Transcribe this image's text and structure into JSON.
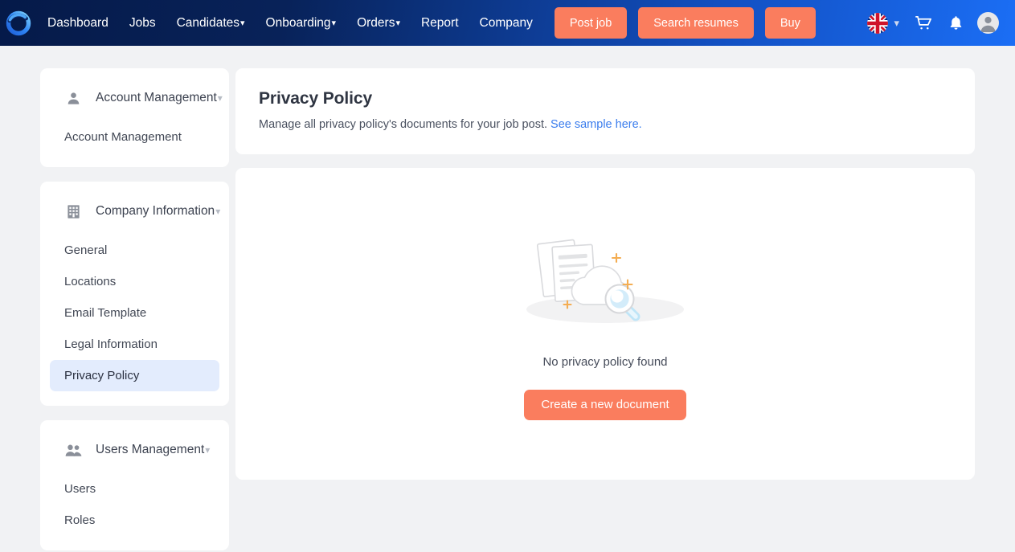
{
  "navbar": {
    "logo_icon": "brand-ring-logo",
    "links": [
      {
        "label": "Dashboard",
        "has_caret": false
      },
      {
        "label": "Jobs",
        "has_caret": false
      },
      {
        "label": "Candidates",
        "has_caret": true
      },
      {
        "label": "Onboarding",
        "has_caret": true
      },
      {
        "label": "Orders",
        "has_caret": true
      },
      {
        "label": "Report",
        "has_caret": false
      },
      {
        "label": "Company",
        "has_caret": false
      }
    ],
    "buttons": [
      {
        "label": "Post job"
      },
      {
        "label": "Search resumes"
      },
      {
        "label": "Buy"
      }
    ],
    "language": {
      "flag": "uk-flag-icon",
      "caret": "⌄"
    },
    "icons": [
      {
        "name": "cart-icon"
      },
      {
        "name": "bell-icon"
      },
      {
        "name": "avatar-icon"
      }
    ],
    "accent_color": "#fa7d5e",
    "gradient_from": "#051a49",
    "gradient_to": "#1b6ef5"
  },
  "sidebar": {
    "sections": [
      {
        "icon": "person-icon",
        "title": "Account Management",
        "caret": "⌄",
        "items": [
          {
            "label": "Account Management",
            "active": false
          }
        ]
      },
      {
        "icon": "building-icon",
        "title": "Company Information",
        "caret": "⌄",
        "items": [
          {
            "label": "General",
            "active": false
          },
          {
            "label": "Locations",
            "active": false
          },
          {
            "label": "Email Template",
            "active": false
          },
          {
            "label": "Legal Information",
            "active": false
          },
          {
            "label": "Privacy Policy",
            "active": true
          }
        ]
      },
      {
        "icon": "users-icon",
        "title": "Users Management",
        "caret": "⌄",
        "items": [
          {
            "label": "Users",
            "active": false
          },
          {
            "label": "Roles",
            "active": false
          }
        ]
      }
    ],
    "active_bg": "#e3ecfd"
  },
  "main": {
    "title": "Privacy Policy",
    "subtitle_text": "Manage all privacy policy's documents for your job post. ",
    "subtitle_link": "See sample here.",
    "empty_state": {
      "illustration": "documents-cloud-search-illustration",
      "message": "No privacy policy found",
      "button_label": "Create a new document"
    }
  }
}
